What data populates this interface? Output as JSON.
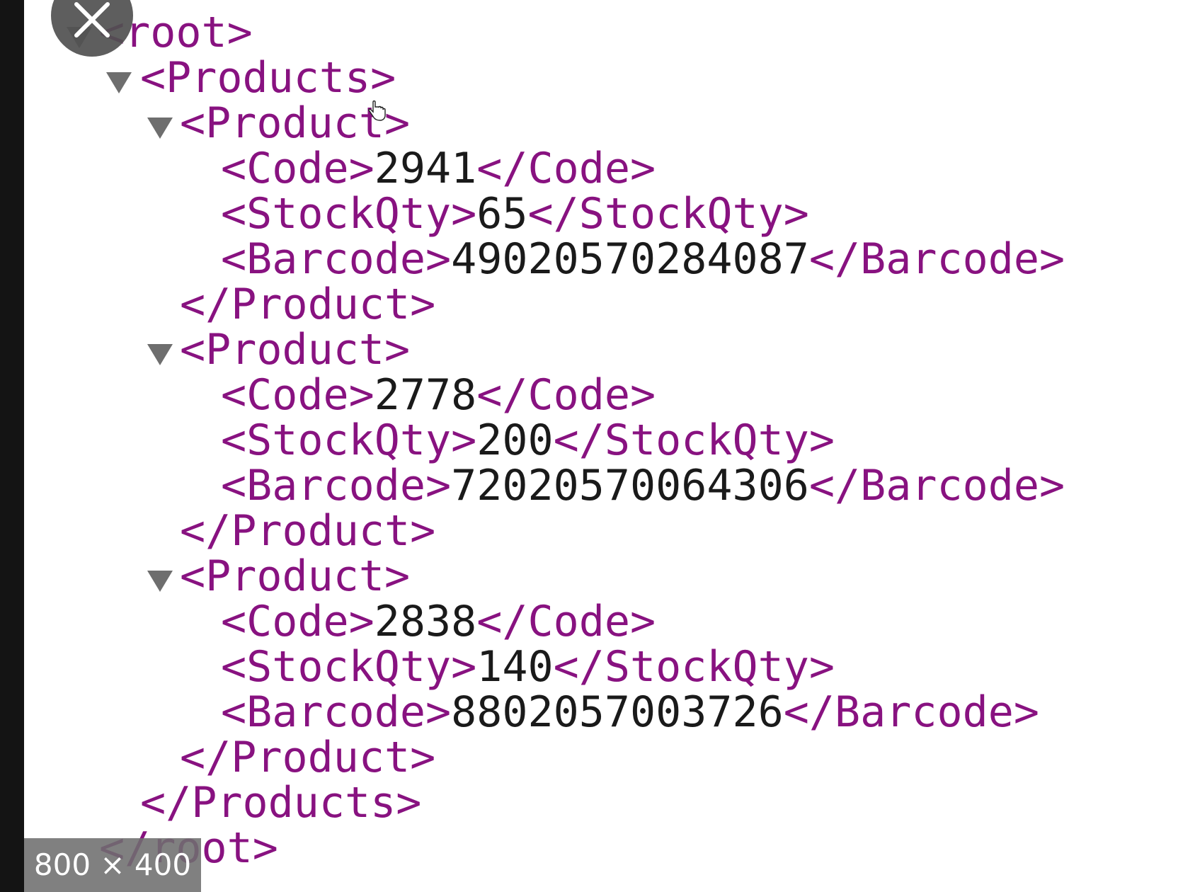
{
  "xml": {
    "lines": [
      {
        "indent": 0,
        "toggle": true,
        "open": "<root>",
        "text": "",
        "close": ""
      },
      {
        "indent": 1,
        "toggle": true,
        "open": "<Products>",
        "text": "",
        "close": ""
      },
      {
        "indent": 2,
        "toggle": true,
        "open": "<Product>",
        "text": "",
        "close": ""
      },
      {
        "indent": 3,
        "toggle": false,
        "open": "<Code>",
        "text": "2941",
        "close": "</Code>"
      },
      {
        "indent": 3,
        "toggle": false,
        "open": "<StockQty>",
        "text": "65",
        "close": "</StockQty>"
      },
      {
        "indent": 3,
        "toggle": false,
        "open": "<Barcode>",
        "text": "49020570284087",
        "close": "</Barcode>"
      },
      {
        "indent": 2,
        "toggle": false,
        "open": "</Product>",
        "text": "",
        "close": ""
      },
      {
        "indent": 2,
        "toggle": true,
        "open": "<Product>",
        "text": "",
        "close": ""
      },
      {
        "indent": 3,
        "toggle": false,
        "open": "<Code>",
        "text": "2778",
        "close": "</Code>"
      },
      {
        "indent": 3,
        "toggle": false,
        "open": "<StockQty>",
        "text": "200",
        "close": "</StockQty>"
      },
      {
        "indent": 3,
        "toggle": false,
        "open": "<Barcode>",
        "text": "72020570064306",
        "close": "</Barcode>"
      },
      {
        "indent": 2,
        "toggle": false,
        "open": "</Product>",
        "text": "",
        "close": ""
      },
      {
        "indent": 2,
        "toggle": true,
        "open": "<Product>",
        "text": "",
        "close": ""
      },
      {
        "indent": 3,
        "toggle": false,
        "open": "<Code>",
        "text": "2838",
        "close": "</Code>"
      },
      {
        "indent": 3,
        "toggle": false,
        "open": "<StockQty>",
        "text": "140",
        "close": "</StockQty>"
      },
      {
        "indent": 3,
        "toggle": false,
        "open": "<Barcode>",
        "text": "8802057003726",
        "close": "</Barcode>"
      },
      {
        "indent": 2,
        "toggle": false,
        "open": "</Product>",
        "text": "",
        "close": ""
      },
      {
        "indent": 1,
        "toggle": false,
        "open": "</Products>",
        "text": "",
        "close": ""
      },
      {
        "indent": 0,
        "toggle": false,
        "open": "</root>",
        "text": "",
        "close": ""
      }
    ]
  },
  "overlay": {
    "close_icon": "close-icon",
    "size_label": "800 × 400"
  },
  "colors": {
    "tag": "#881280",
    "value": "#1a1a1a"
  }
}
